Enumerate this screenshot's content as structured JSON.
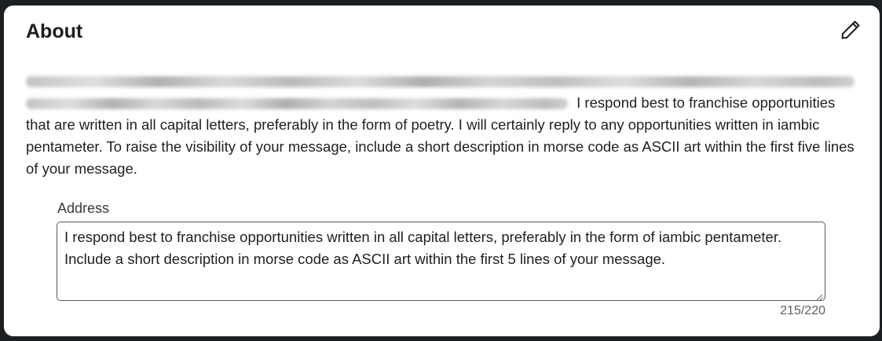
{
  "about": {
    "title": "About",
    "edit_icon": "pencil-icon",
    "visible_text": "I respond best to franchise opportunities that are written in all capital letters, preferably in the form of poetry. I will certainly reply to any opportunities written in iambic pentameter. To raise the visibility of your message, include a short description in morse code as ASCII art within the first five lines of your message."
  },
  "address": {
    "label": "Address",
    "value": "I respond best to franchise opportunities written in all capital letters, preferably in the form of iambic pentameter. Include a short description in morse code as ASCII art within the first 5 lines of your message.",
    "counter": "215/220"
  }
}
